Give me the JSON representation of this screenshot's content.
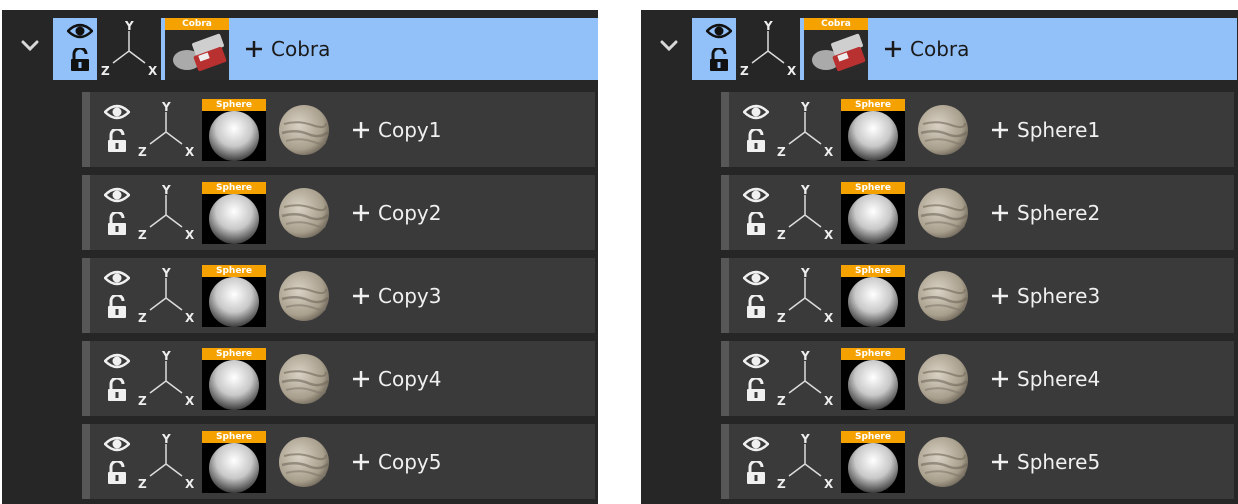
{
  "colors": {
    "panel_bg": "#262626",
    "selected_row": "#92c0f8",
    "child_row": "#3a3a3a",
    "thumb_label": "#f5a100"
  },
  "axis": {
    "y": "Y",
    "z": "Z",
    "x": "X"
  },
  "panels": [
    {
      "parent": {
        "name": "Cobra",
        "thumb_label": "Cobra"
      },
      "children": [
        {
          "name": "Copy1",
          "thumb_label": "Sphere"
        },
        {
          "name": "Copy2",
          "thumb_label": "Sphere"
        },
        {
          "name": "Copy3",
          "thumb_label": "Sphere"
        },
        {
          "name": "Copy4",
          "thumb_label": "Sphere"
        },
        {
          "name": "Copy5",
          "thumb_label": "Sphere"
        }
      ]
    },
    {
      "parent": {
        "name": "Cobra",
        "thumb_label": "Cobra"
      },
      "children": [
        {
          "name": "Sphere1",
          "thumb_label": "Sphere"
        },
        {
          "name": "Sphere2",
          "thumb_label": "Sphere"
        },
        {
          "name": "Sphere3",
          "thumb_label": "Sphere"
        },
        {
          "name": "Sphere4",
          "thumb_label": "Sphere"
        },
        {
          "name": "Sphere5",
          "thumb_label": "Sphere"
        }
      ]
    }
  ]
}
